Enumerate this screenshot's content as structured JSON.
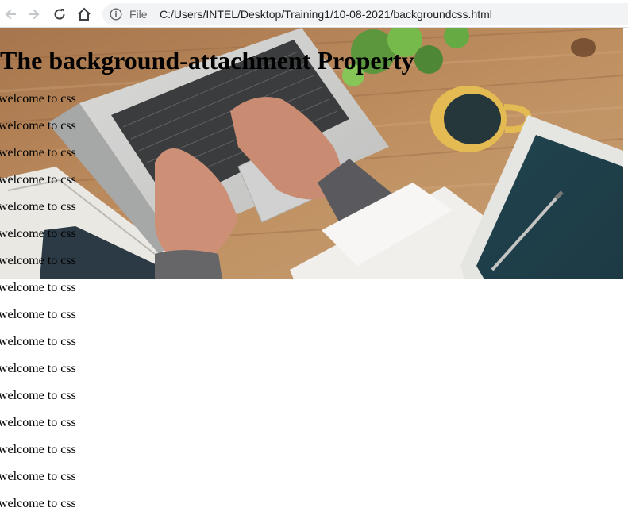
{
  "browser": {
    "file_label": "File",
    "url": "C:/Users/INTEL/Desktop/Training1/10-08-2021/backgroundcss.html"
  },
  "page": {
    "heading": "The background-attachment Property",
    "lines": [
      "welcome to css",
      "welcome to css",
      "welcome to css",
      "welcome to css",
      "welcome to css",
      "welcome to css",
      "welcome to css",
      "welcome to css",
      "welcome to css",
      "welcome to css",
      "welcome to css",
      "welcome to css",
      "welcome to css",
      "welcome to css",
      "welcome to css",
      "welcome to css"
    ]
  },
  "icons": {
    "back": "arrow-left-icon",
    "forward": "arrow-right-icon",
    "reload": "reload-icon",
    "home": "home-icon",
    "info": "info-icon"
  },
  "colors": {
    "toolbar_bg": "#ffffff",
    "omnibox_bg": "#f1f3f4",
    "text": "#000000",
    "url_text": "#202124",
    "muted": "#5f6368"
  }
}
